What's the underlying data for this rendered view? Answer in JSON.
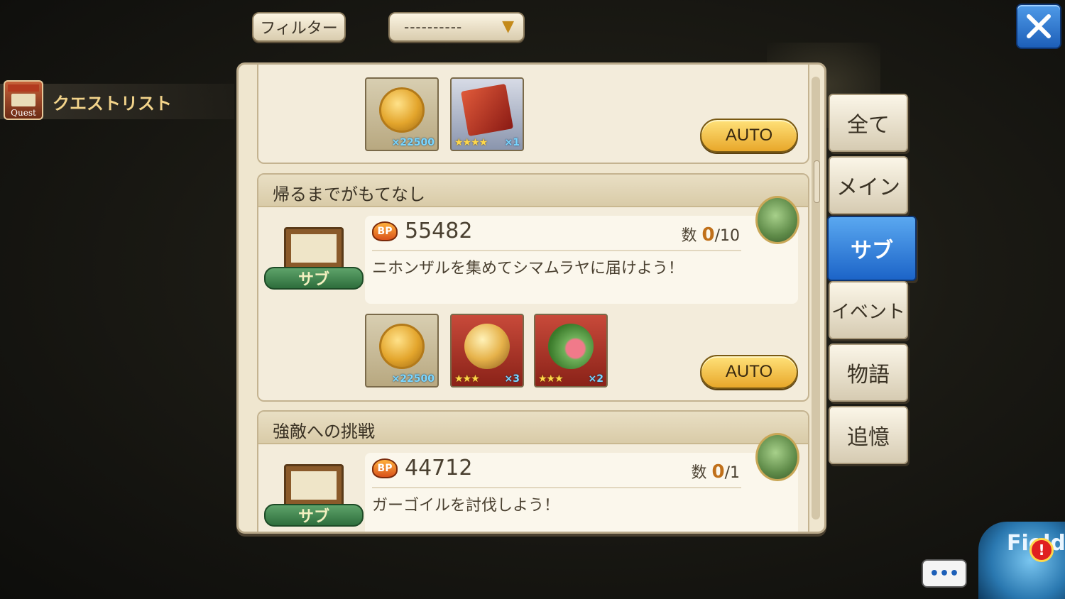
{
  "header": {
    "filter_label": "フィルター",
    "filter_select_value": "----------"
  },
  "side": {
    "icon_label": "Quest",
    "title": "クエストリスト"
  },
  "cards": [
    {
      "title": "",
      "rewards": [
        {
          "icon": "coin",
          "qty": "×22500"
        },
        {
          "icon": "book",
          "stars": "★★★★",
          "qty": "×1"
        }
      ],
      "auto_label": "AUTO"
    },
    {
      "title": "帰るまでがもてなし",
      "ribbon": "サブ",
      "bp_label": "BP",
      "bp_value": "55482",
      "count_prefix": "数",
      "count_current": "0",
      "count_total": "/10",
      "description": "ニホンザルを集めてシマムラヤに届けよう！",
      "rewards": [
        {
          "icon": "coin",
          "qty": "×22500"
        },
        {
          "icon": "orb",
          "stars": "★★★",
          "qty": "×3"
        },
        {
          "icon": "guava",
          "stars": "★★★",
          "qty": "×2"
        }
      ],
      "auto_label": "AUTO"
    },
    {
      "title": "強敵への挑戦",
      "ribbon": "サブ",
      "bp_label": "BP",
      "bp_value": "44712",
      "count_prefix": "数",
      "count_current": "0",
      "count_total": "/1",
      "description": "ガーゴイルを討伐しよう！"
    }
  ],
  "tabs": [
    "全て",
    "メイン",
    "サブ",
    "イベント",
    "物語",
    "追憶"
  ],
  "active_tab": "サブ",
  "bottom": {
    "chat_label": "•••",
    "field_label": "Field",
    "alert_label": "!"
  },
  "colors": {
    "accent_blue": "#1c64c8",
    "auto_gold": "#e8a72a",
    "panel_bg": "#efe6cf"
  }
}
